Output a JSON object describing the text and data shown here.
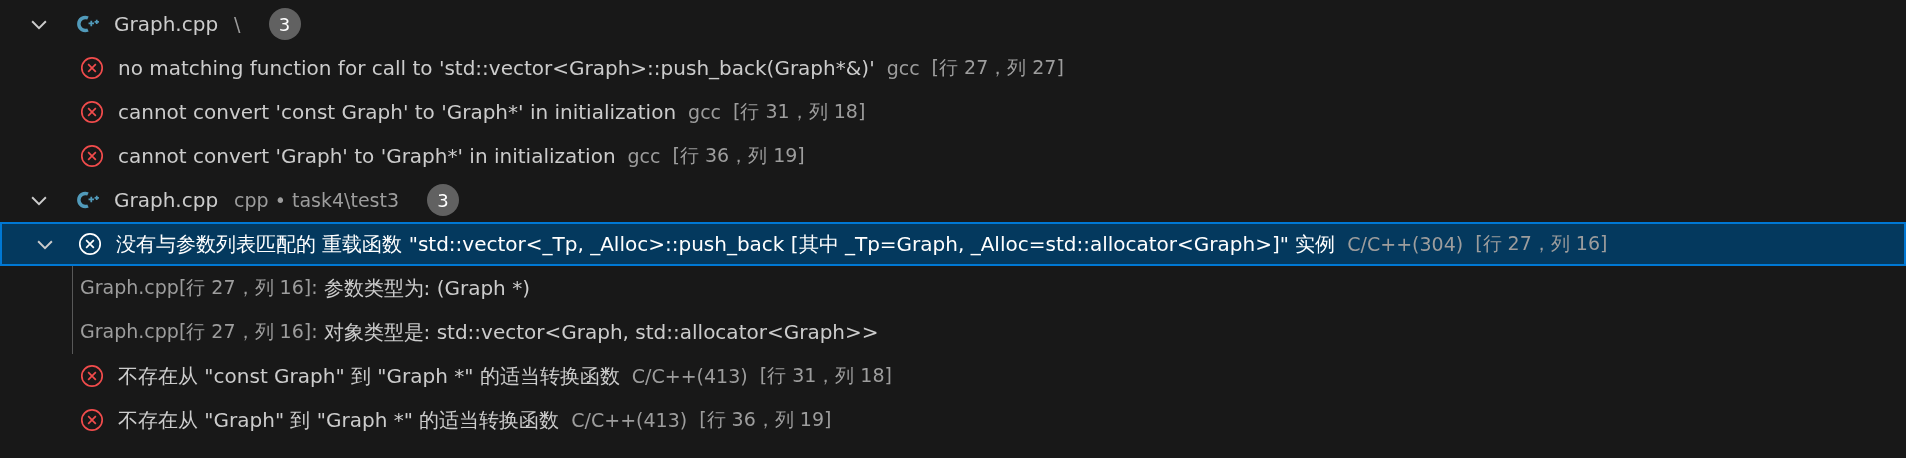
{
  "groups": [
    {
      "name": "Graph.cpp",
      "path": "\\",
      "count": "3",
      "expanded": true,
      "problems": [
        {
          "kind": "error",
          "message": "no matching function for call to 'std::vector<Graph>::push_back(Graph*&)'",
          "source": "gcc",
          "location": "[行 27，列 27]",
          "selected": false
        },
        {
          "kind": "error",
          "message": "cannot convert 'const Graph' to 'Graph*' in initialization",
          "source": "gcc",
          "location": "[行 31，列 18]",
          "selected": false
        },
        {
          "kind": "error",
          "message": "cannot convert 'Graph' to 'Graph*' in initialization",
          "source": "gcc",
          "location": "[行 36，列 19]",
          "selected": false
        }
      ]
    },
    {
      "name": "Graph.cpp",
      "path": "cpp • task4\\test3",
      "count": "3",
      "expanded": true,
      "problems": [
        {
          "kind": "error",
          "message": "没有与参数列表匹配的 重载函数 \"std::vector<_Tp, _Alloc>::push_back [其中 _Tp=Graph, _Alloc=std::allocator<Graph>]\" 实例",
          "source": "C/C++(304)",
          "location": "[行 27，列 16]",
          "selected": true,
          "expanded": true,
          "related": [
            {
              "origin": "Graph.cpp[行 27，列 16]:",
              "message": "参数类型为: (Graph *)"
            },
            {
              "origin": "Graph.cpp[行 27，列 16]:",
              "message": "对象类型是: std::vector<Graph, std::allocator<Graph>>"
            }
          ]
        },
        {
          "kind": "error",
          "message": "不存在从 \"const Graph\" 到 \"Graph *\" 的适当转换函数",
          "source": "C/C++(413)",
          "location": "[行 31，列 18]",
          "selected": false
        },
        {
          "kind": "error",
          "message": "不存在从 \"Graph\" 到 \"Graph *\" 的适当转换函数",
          "source": "C/C++(413)",
          "location": "[行 36，列 19]",
          "selected": false
        }
      ]
    }
  ]
}
